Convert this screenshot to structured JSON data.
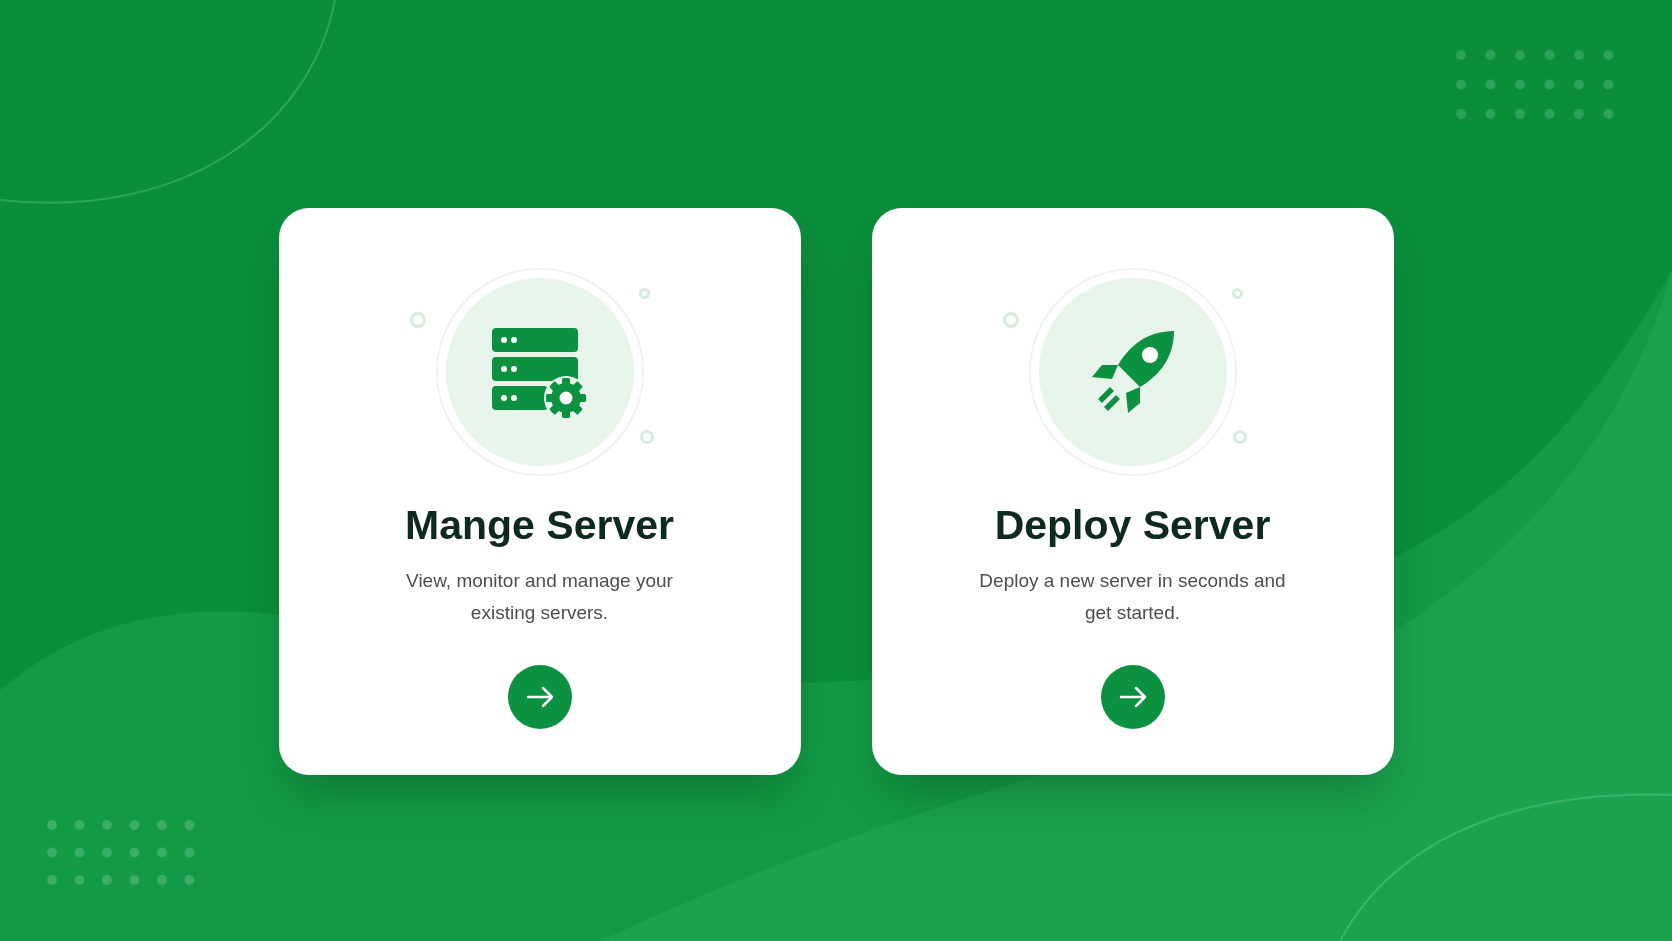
{
  "cards": [
    {
      "kind": "server",
      "title": "Mange Server",
      "description": "View, monitor and manage your existing servers."
    },
    {
      "kind": "rocket",
      "title": "Deploy Server",
      "description": "Deploy a new server in seconds and get started."
    }
  ]
}
